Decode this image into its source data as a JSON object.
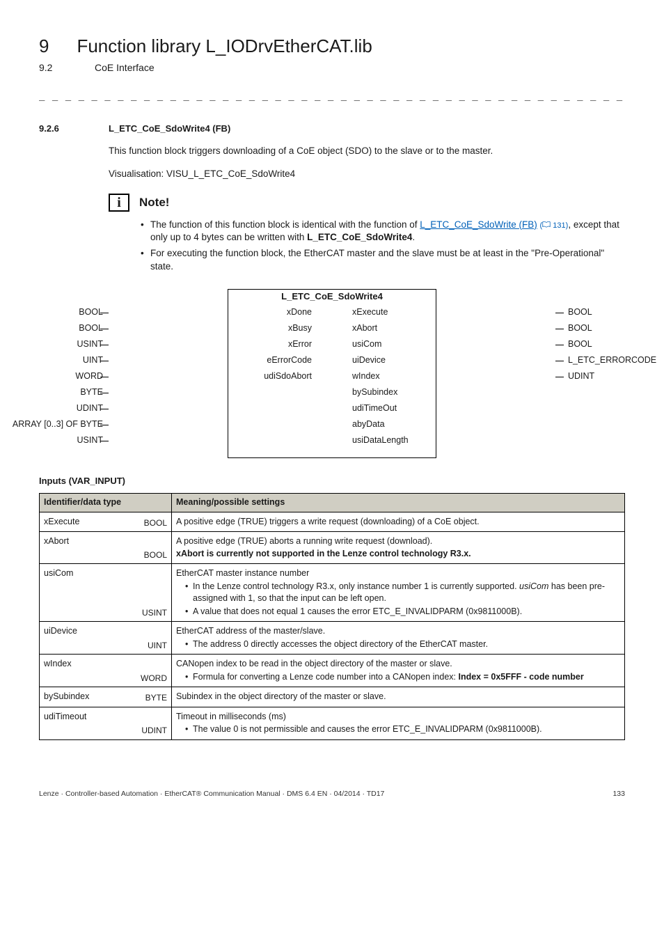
{
  "header": {
    "chapter_num": "9",
    "chapter_title": "Function library L_IODrvEtherCAT.lib",
    "section_num": "9.2",
    "section_title": "CoE Interface"
  },
  "dashes": "_ _ _ _ _ _ _ _ _ _ _ _ _ _ _ _ _ _ _ _ _ _ _ _ _ _ _ _ _ _ _ _ _ _ _ _ _ _ _ _ _ _ _ _ _ _ _ _ _ _ _ _ _ _ _ _ _ _ _ _ _ _ _ _",
  "section": {
    "num": "9.2.6",
    "title": "L_ETC_CoE_SdoWrite4 (FB)"
  },
  "para1": "This function block triggers downloading of a CoE object (SDO) to the slave or to the master.",
  "para2": "Visualisation: VISU_L_ETC_CoE_SdoWrite4",
  "note": {
    "label": "Note!",
    "b1a": "The function of this function block is identical with the function of ",
    "b1_link": "L_ETC_CoE_SdoWrite (FB)",
    "b1_pg": "131",
    "b1b": ", except that only up to 4 bytes can be written with ",
    "b1_bold": "L_ETC_CoE_SdoWrite4",
    "b1c": ".",
    "b2": "For executing the function block, the EtherCAT master and the slave must be at least in the \"Pre-Operational\" state."
  },
  "fbd": {
    "title": "L_ETC_CoE_SdoWrite4",
    "rows": [
      {
        "it": "BOOL",
        "in": "xExecute",
        "on": "xDone",
        "ot": "BOOL"
      },
      {
        "it": "BOOL",
        "in": "xAbort",
        "on": "xBusy",
        "ot": "BOOL"
      },
      {
        "it": "USINT",
        "in": "usiCom",
        "on": "xError",
        "ot": "BOOL"
      },
      {
        "it": "UINT",
        "in": "uiDevice",
        "on": "eErrorCode",
        "ot": "L_ETC_ERRORCODE"
      },
      {
        "it": "WORD",
        "in": "wIndex",
        "on": "udiSdoAbort",
        "ot": "UDINT"
      },
      {
        "it": "BYTE",
        "in": "bySubindex"
      },
      {
        "it": "UDINT",
        "in": "udiTimeOut"
      },
      {
        "it": "ARRAY [0..3] OF BYTE",
        "in": "abyData"
      },
      {
        "it": "USINT",
        "in": "usiDataLength"
      }
    ]
  },
  "inputs_title": "Inputs (VAR_INPUT)",
  "th1": "Identifier/data type",
  "th2": "Meaning/possible settings",
  "rows": {
    "xExecute": {
      "name": "xExecute",
      "type": "BOOL",
      "t1": "A positive edge (TRUE) triggers a write request (downloading) of a CoE object."
    },
    "xAbort": {
      "name": "xAbort",
      "type": "BOOL",
      "t1": "A positive edge (TRUE) aborts a running write request (download).",
      "t2": "xAbort is currently not supported in the Lenze control technology R3.x."
    },
    "usiCom": {
      "name": "usiCom",
      "type": "USINT",
      "t1": "EtherCAT master instance number",
      "b1a": "In the Lenze control technology R3.x, only instance number 1 is currently supported. ",
      "b1_ital": "usiCom",
      "b1b": " has been pre-assigned with 1,  so that the input can be left open.",
      "b2": "A value that does not equal 1 causes the error ETC_E_INVALIDPARM (0x9811000B)."
    },
    "uiDevice": {
      "name": "uiDevice",
      "type": "UINT",
      "t1": "EtherCAT address of the master/slave.",
      "b1": "The address 0 directly accesses the object directory of the EtherCAT master."
    },
    "wIndex": {
      "name": "wIndex",
      "type": "WORD",
      "t1": "CANopen index to be read in the object directory of the master or slave.",
      "b1a": "Formula for converting a Lenze code number into a CANopen index: ",
      "b1_bold": "Index = 0x5FFF - code number"
    },
    "bySubindex": {
      "name": "bySubindex",
      "type": "BYTE",
      "t1": "Subindex in the object directory of the master or slave."
    },
    "udiTimeout": {
      "name": "udiTimeout",
      "type": "UDINT",
      "t1": "Timeout in milliseconds (ms)",
      "b1": "The value 0 is not permissible and causes the error ETC_E_INVALIDPARM (0x9811000B)."
    }
  },
  "footer": {
    "left": "Lenze · Controller-based Automation · EtherCAT® Communication Manual · DMS 6.4 EN · 04/2014 · TD17",
    "right": "133"
  }
}
